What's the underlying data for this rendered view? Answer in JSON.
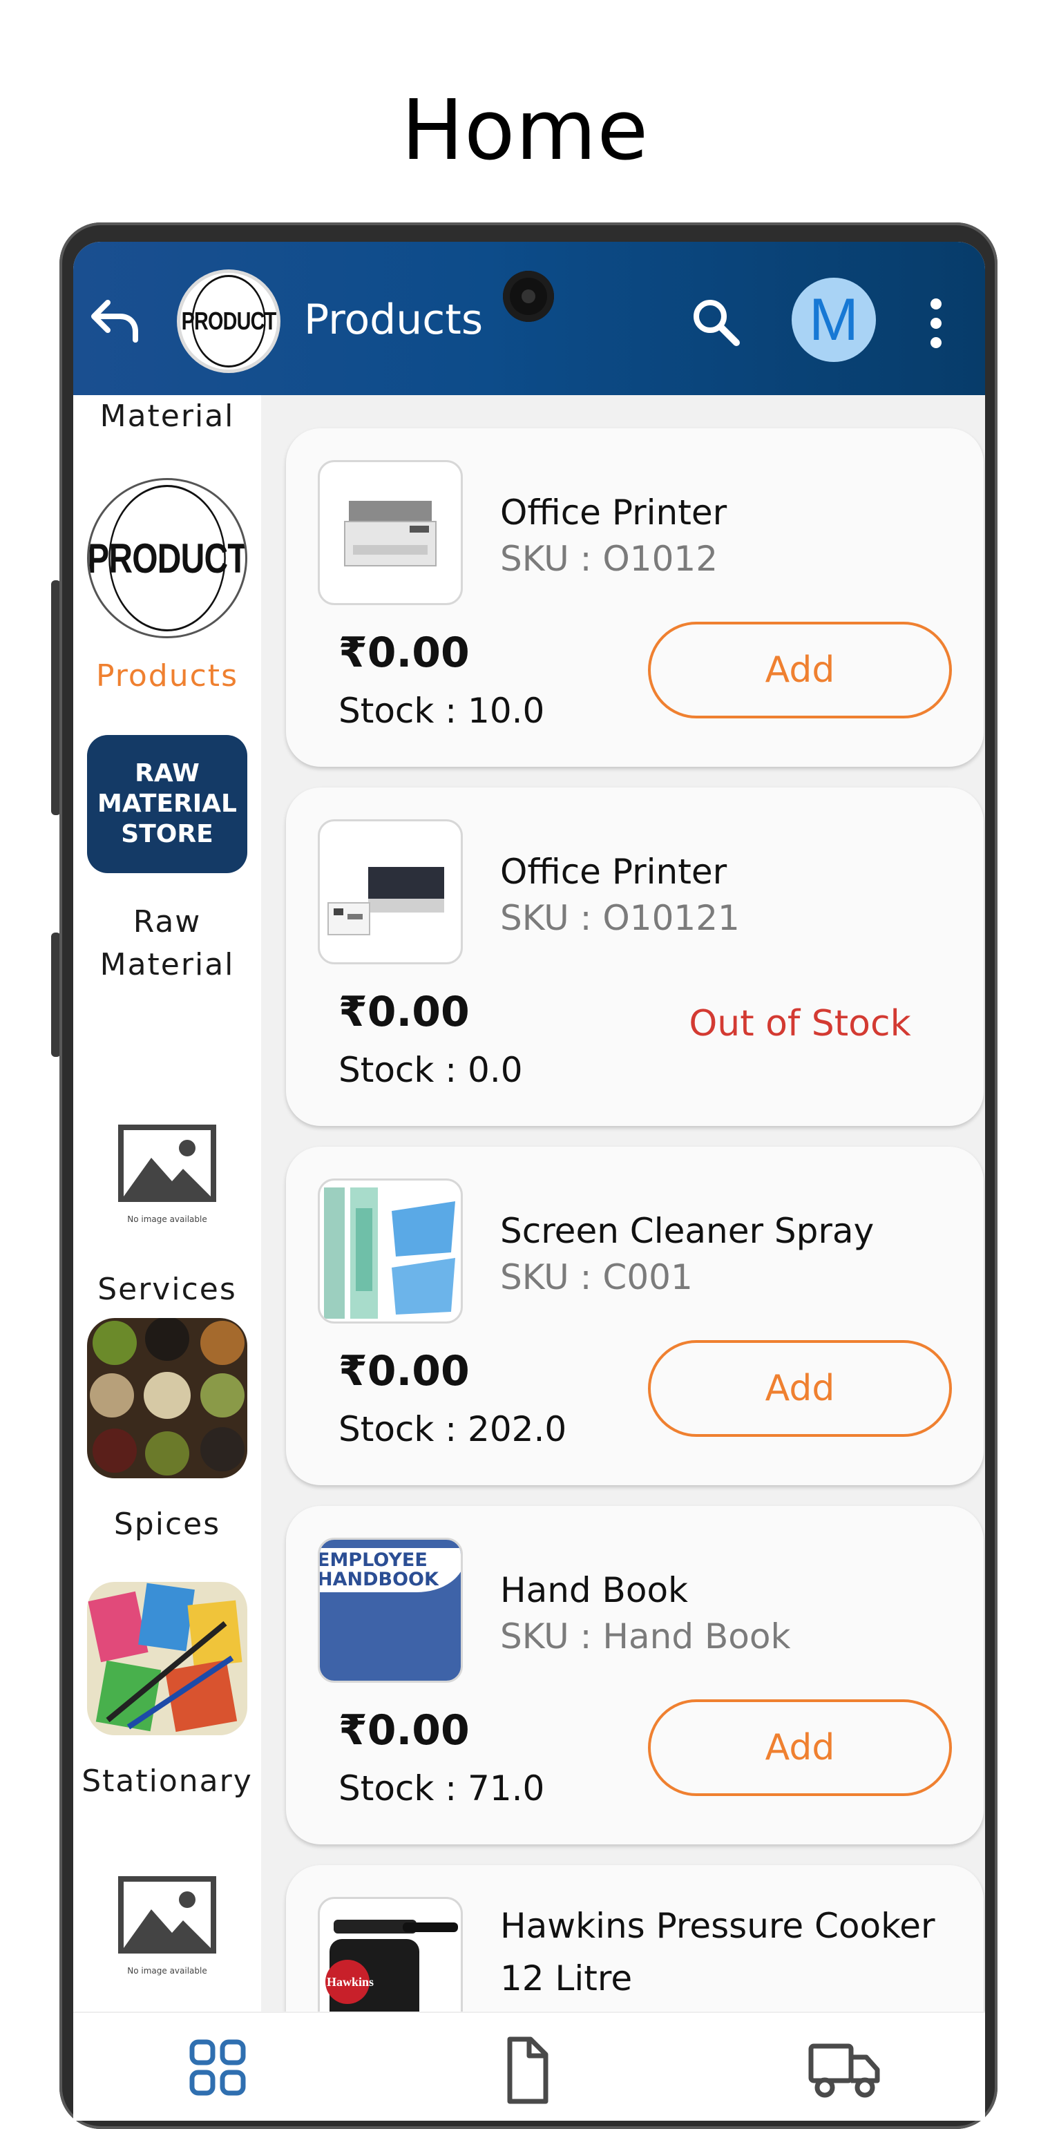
{
  "headline": "Home",
  "appbar": {
    "title": "Products",
    "logo_text": "PRODUCT",
    "avatar_letter": "M",
    "icons": [
      "back-arrow-icon",
      "search-icon",
      "more-vertical-icon"
    ]
  },
  "sidebar": {
    "items": [
      {
        "label": "Material",
        "image": "none"
      },
      {
        "label": "Products",
        "image": "product-logo",
        "logo_text": "PRODUCT",
        "active": true
      },
      {
        "label": "Raw\nMaterial",
        "image": "raw-material-logo",
        "image_text": [
          "RAW",
          "MATERIAL",
          "STORE"
        ]
      },
      {
        "label": "Services",
        "image": "no-image-placeholder",
        "placeholder_text": "No image available"
      },
      {
        "label": "Spices",
        "image": "spices-photo"
      },
      {
        "label": "Stationary",
        "image": "stationary-photo"
      },
      {
        "label": "",
        "image": "no-image-placeholder",
        "placeholder_text": "No image available"
      }
    ]
  },
  "products": [
    {
      "name": "Office Printer",
      "sku": "SKU : O1012",
      "price": "₹0.00",
      "stock": "Stock : 10.0",
      "action": "Add",
      "thumb": "printer-photo"
    },
    {
      "name": "Office Printer",
      "sku": "SKU : O10121",
      "price": "₹0.00",
      "stock": "Stock : 0.0",
      "status": "Out of Stock",
      "thumb": "printer-photo"
    },
    {
      "name": "Screen Cleaner Spray",
      "sku": "SKU : C001",
      "price": "₹0.00",
      "stock": "Stock : 202.0",
      "action": "Add",
      "thumb": "cleaner-spray-photo"
    },
    {
      "name": "Hand Book",
      "sku": "SKU : Hand Book",
      "price": "₹0.00",
      "stock": "Stock : 71.0",
      "action": "Add",
      "thumb": "handbook-photo",
      "thumb_text": [
        "EMPLOYEE",
        "HANDBOOK"
      ]
    },
    {
      "name": "Hawkins Pressure Cooker 12 Litre",
      "thumb": "pressure-cooker-photo",
      "thumb_text": "Hawkins"
    }
  ],
  "bottom_nav": {
    "icons": [
      "grid-icon",
      "document-icon",
      "truck-icon"
    ]
  },
  "colors": {
    "appbar": "#0d4c8a",
    "accent": "#ef8030",
    "out_of_stock": "#d33a32",
    "avatar_bg": "#a9d3f5",
    "avatar_fg": "#1778d4",
    "nav_icons": "#2f6fb0"
  }
}
